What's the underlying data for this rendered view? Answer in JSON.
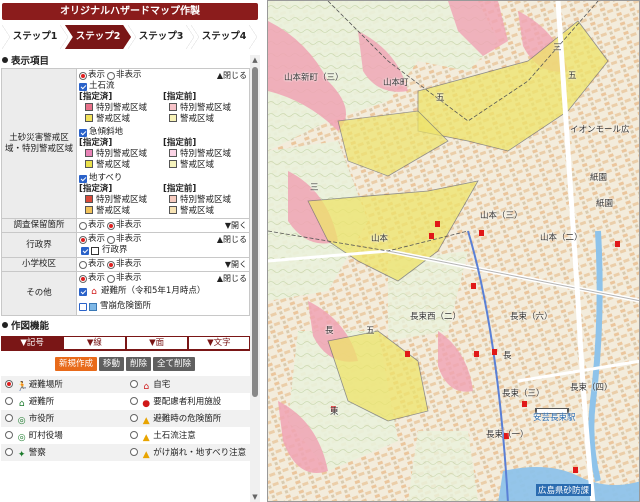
{
  "title": "オリジナルハザードマップ作製",
  "steps": [
    "ステップ1",
    "ステップ2",
    "ステップ3",
    "ステップ4"
  ],
  "active_step": 1,
  "display_section": {
    "heading": "表示項目",
    "show": "表示",
    "hide": "非表示",
    "close": "▲閉じる",
    "open": "▼開く",
    "sediment": {
      "label": "土砂災害警戒区域・特別警戒区域",
      "designated": "[指定済]",
      "before": "[指定前]",
      "special": "特別警戒区域",
      "warning": "警戒区域",
      "groups": [
        {
          "name": "土石流",
          "special_color": "#e8728a",
          "warning_color": "#f2e25a",
          "before_special_color": "#f7c3c8",
          "before_warning_color": "#f7f2b8"
        },
        {
          "name": "急傾斜地",
          "special_color": "#e883b6",
          "warning_color": "#eae04a",
          "before_special_color": "#fbd4e6",
          "before_warning_color": "#f5f3bd"
        },
        {
          "name": "地すべり",
          "special_color": "#d94a3a",
          "warning_color": "#f2c35a",
          "before_special_color": "#f6cbbf",
          "before_warning_color": "#f7e3b4"
        }
      ]
    },
    "survey": {
      "label": "調査保留箇所"
    },
    "admin": {
      "label": "行政界",
      "item": "行政界"
    },
    "school": {
      "label": "小学校区"
    },
    "other": {
      "label": "その他",
      "shelter": "避難所（令和5年1月時点）",
      "avalanche": "雪崩危険箇所"
    }
  },
  "drawing_section": {
    "heading": "作図機能",
    "tabs": [
      "▼記号",
      "▼線",
      "▼面",
      "▼文字"
    ],
    "buttons": [
      "新規作成",
      "移動",
      "削除",
      "全て削除"
    ],
    "symbols": [
      [
        "避難場所",
        "自宅"
      ],
      [
        "避難所",
        "要配慮者利用施設"
      ],
      [
        "市役所",
        "避難時の危険箇所"
      ],
      [
        "町村役場",
        "土石流注意"
      ],
      [
        "警察",
        "がけ崩れ・地すべり注意"
      ]
    ]
  },
  "map": {
    "labels": [
      "山本新町（三）",
      "山本町",
      "山本",
      "五",
      "五",
      "イオンモール広",
      "紙園",
      "紙園",
      "山本（三）",
      "山本（二）",
      "長束西（二）",
      "長束（六）",
      "長",
      "長",
      "五",
      "東",
      "広島県砂防課",
      "安芸長束駅",
      "長束（一）",
      "長束（三）",
      "長束（四）",
      "三",
      "三"
    ]
  }
}
